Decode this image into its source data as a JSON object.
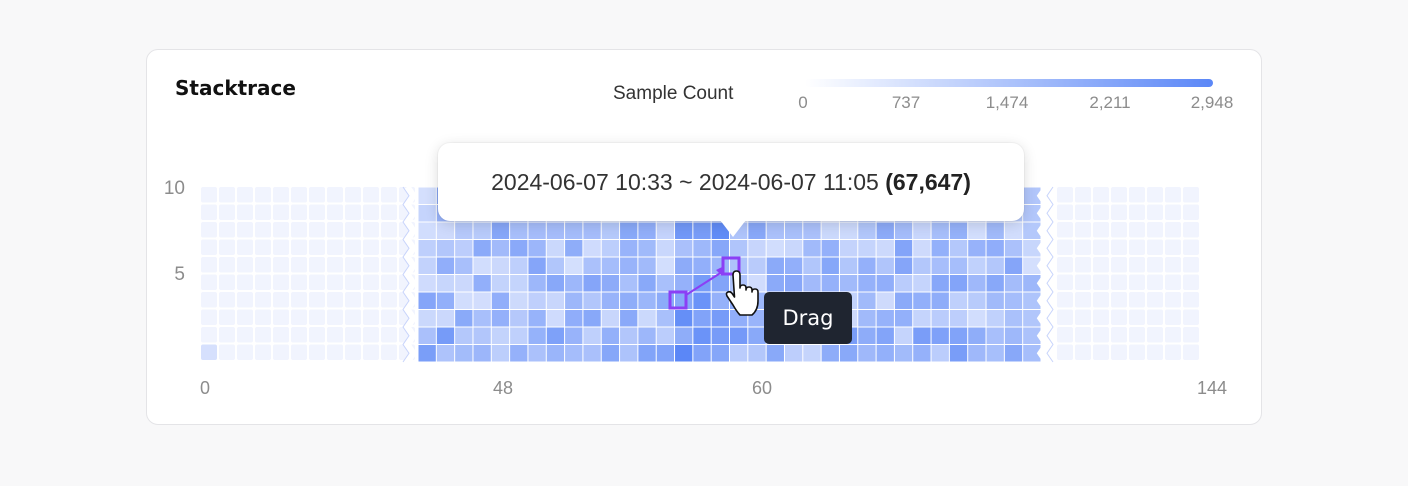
{
  "panel": {
    "title": "Stacktrace"
  },
  "legend": {
    "title": "Sample Count",
    "ticks": [
      "0",
      "737",
      "1,474",
      "2,211",
      "2,948"
    ],
    "min_color": "#ffffff",
    "max_color": "#5b87f7"
  },
  "tooltip": {
    "range_text": "2024-06-07 10:33 ~ 2024-06-07 11:05",
    "total_text": "(67,647)"
  },
  "drag_hint": "Drag",
  "colors": {
    "cell_base": "#eef2fe",
    "selection": "#8b3ff5",
    "drag_label_bg": "#1f2530"
  },
  "chart_data": {
    "type": "heatmap",
    "title": "Stacktrace",
    "color_scale": {
      "label": "Sample Count",
      "min": 0,
      "max": 2948
    },
    "x_tick_labels": [
      "0",
      "48",
      "60",
      "144"
    ],
    "y_tick_labels": [
      "10",
      "5"
    ],
    "x_range": [
      0,
      144
    ],
    "y_range": [
      0,
      10
    ],
    "selected_range": "2024-06-07 10:33 ~ 2024-06-07 11:05",
    "selected_total": 67647,
    "active_columns": [
      48,
      82
    ],
    "drag_selection": {
      "from_cell": [
        57,
        3
      ],
      "to_cell": [
        60,
        5
      ]
    }
  }
}
